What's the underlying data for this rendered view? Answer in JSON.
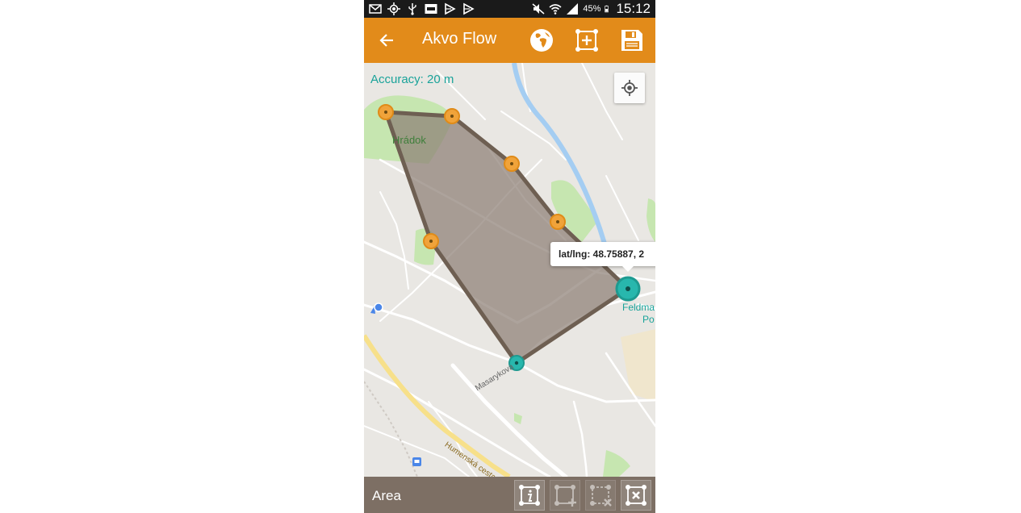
{
  "status_bar": {
    "battery": "45%",
    "time": "15:12"
  },
  "app_bar": {
    "title": "Akvo Flow",
    "icons": [
      "back-arrow-icon",
      "globe-icon",
      "add-point-icon",
      "save-icon"
    ]
  },
  "map": {
    "accuracy_text": "Accuracy: 20 m",
    "place_labels": {
      "hradok": "Hrádok",
      "masarykova": "Masarykova",
      "humenska": "Humenská cesta",
      "feldmarsal_1": "Feldma",
      "feldmarsal_2": "Po"
    },
    "tooltip_text": "lat/lng: 48.75887, 2",
    "polygon_fill": "#8e7f76",
    "polygon_stroke": "#6e5f52",
    "vertex_color_orange": "#f0a33a",
    "vertex_color_teal": "#28b7ad"
  },
  "bottom_bar": {
    "area_label": "Area",
    "buttons": [
      "info-icon",
      "add-vertex-icon",
      "remove-vertex-icon",
      "delete-shape-icon"
    ]
  },
  "colors": {
    "app_bar": "#e28b1a",
    "status_bar": "#1a1a1a",
    "bottom_bar": "#7d6f64",
    "accuracy_text": "#1aa39a"
  }
}
